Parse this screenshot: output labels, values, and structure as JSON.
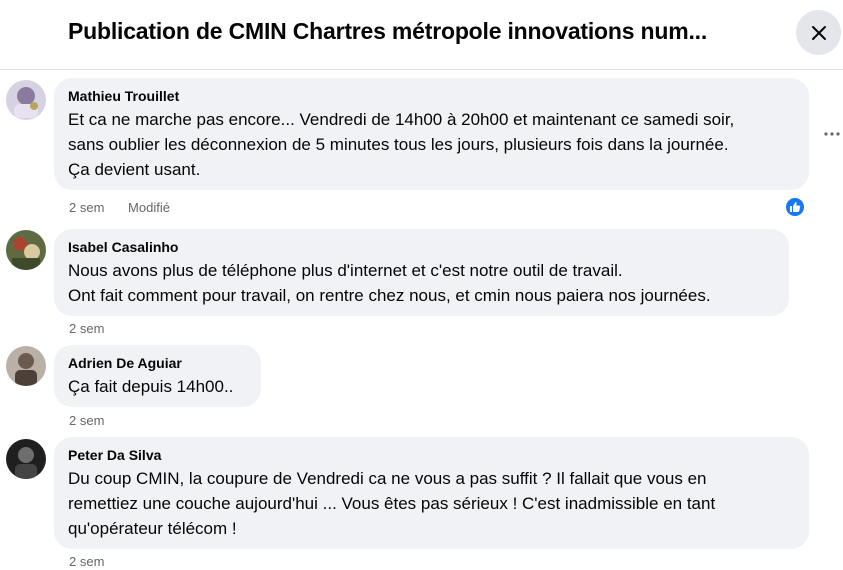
{
  "header": {
    "title": "Publication de CMIN Chartres métropole innovations num..."
  },
  "comments": [
    {
      "author": "Mathieu Trouillet",
      "text_lines": [
        "Et ca ne marche pas encore... Vendredi de 14h00 à 20h00 et maintenant ce samedi soir,",
        "sans oublier les déconnexion de 5 minutes tous les jours, plusieurs fois dans la journée.",
        "Ça devient usant."
      ],
      "time": "2 sem",
      "edited": "Modifié",
      "reaction": "like-icon",
      "avatar_color": "#c9c3d6"
    },
    {
      "author": "Isabel Casalinho",
      "text_lines": [
        "Nous avons plus de téléphone plus d'internet et c'est notre outil de travail.",
        "Ont fait comment pour travail, on rentre chez nous, et cmin nous paiera nos journées."
      ],
      "time": "2 sem",
      "avatar_color": "#6f7a4f"
    },
    {
      "author": "Adrien De Aguiar",
      "text_lines": [
        "Ça fait depuis 14h00.."
      ],
      "time": "2 sem",
      "avatar_color": "#9a8f86"
    },
    {
      "author": "Peter Da Silva",
      "text_lines": [
        "Du coup CMIN, la coupure de Vendredi ca ne vous a pas suffit ? Il fallait que vous en",
        "remettiez une couche aujourd'hui ... Vous êtes pas sérieux ! C'est inadmissible en tant",
        "qu'opérateur télécom !"
      ],
      "time": "2 sem",
      "avatar_color": "#2a2a2a"
    }
  ],
  "icons": {
    "close": "close-icon",
    "more": "more-options-icon",
    "like": "like-icon"
  },
  "colors": {
    "bubble": "#f0f2f5",
    "meta_text": "#65676b",
    "like_blue": "#1877f2",
    "close_bg": "#e4e6eb"
  }
}
